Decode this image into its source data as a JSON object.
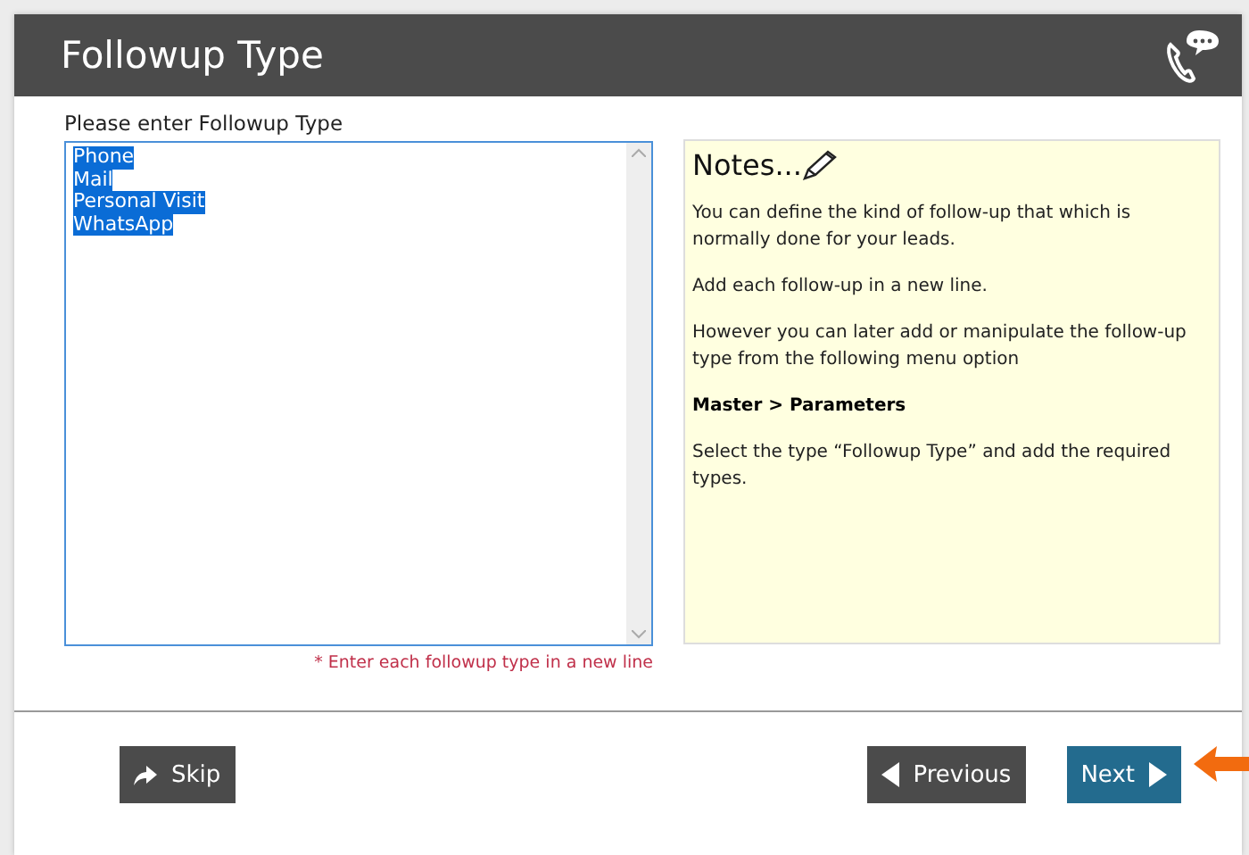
{
  "header": {
    "title": "Followup Type"
  },
  "entry": {
    "label": "Please enter Followup Type",
    "lines": [
      {
        "text": "Phone",
        "selected": true
      },
      {
        "text": "Mail",
        "selected": true
      },
      {
        "text": "Personal Visit",
        "selected": true
      },
      {
        "text": "WhatsApp",
        "selected": true
      }
    ],
    "hint": "* Enter each followup type in a new line"
  },
  "notes": {
    "title": "Notes...",
    "paragraphs": [
      {
        "kind": "text",
        "text": "You can define the kind of follow-up that which is normally done for your leads."
      },
      {
        "kind": "text",
        "text": "Add each follow-up in a new line."
      },
      {
        "kind": "text",
        "text": "However you can later add or manipulate the follow-up type from the following menu option"
      },
      {
        "kind": "bold",
        "text": "Master > Parameters"
      },
      {
        "kind": "text",
        "text": "Select the type “Followup Type” and add the required types."
      }
    ]
  },
  "buttons": [
    {
      "kind": "skip",
      "label": "Skip"
    },
    {
      "kind": "previous",
      "label": "Previous"
    },
    {
      "kind": "next",
      "label": "Next"
    }
  ]
}
